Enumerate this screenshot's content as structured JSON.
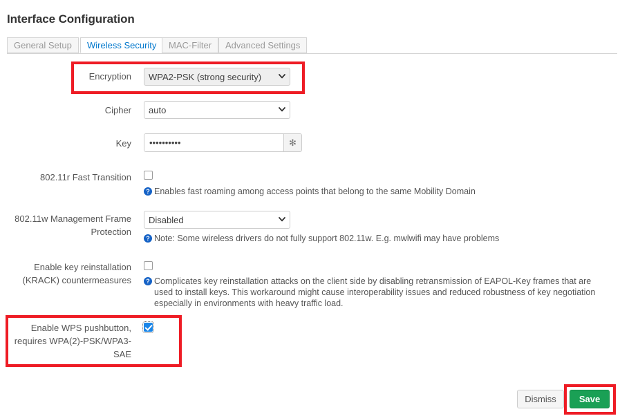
{
  "header": {
    "title": "Interface Configuration"
  },
  "tabs": [
    {
      "label": "General Setup",
      "active": false
    },
    {
      "label": "Wireless Security",
      "active": true
    },
    {
      "label": "MAC-Filter",
      "active": false
    },
    {
      "label": "Advanced Settings",
      "active": false
    }
  ],
  "form": {
    "encryption": {
      "label": "Encryption",
      "value": "WPA2-PSK (strong security)"
    },
    "cipher": {
      "label": "Cipher",
      "value": "auto"
    },
    "key": {
      "label": "Key",
      "value": "••••••••••",
      "placeholder": "",
      "reveal_label": "✻"
    },
    "fast_transition": {
      "label": "802.11r Fast Transition",
      "checked": false,
      "help_icon": "question-circle-icon",
      "hint": "Enables fast roaming among access points that belong to the same Mobility Domain"
    },
    "mfp": {
      "label": "802.11w Management Frame Protection",
      "value": "Disabled",
      "help_icon": "question-circle-icon",
      "hint": "Note: Some wireless drivers do not fully support 802.11w. E.g. mwlwifi may have problems"
    },
    "krack": {
      "label": "Enable key reinstallation (KRACK) countermeasures",
      "checked": false,
      "help_icon": "question-circle-icon",
      "hint": "Complicates key reinstallation attacks on the client side by disabling retransmission of EAPOL-Key frames that are used to install keys. This workaround might cause interoperability issues and reduced robustness of key negotiation especially in environments with heavy traffic load."
    },
    "wps": {
      "label": "Enable WPS pushbutton, requires WPA(2)-PSK/WPA3-SAE",
      "checked": true
    }
  },
  "footer": {
    "dismiss_label": "Dismiss",
    "save_label": "Save"
  },
  "colors": {
    "highlight": "#ee1c25",
    "save_green": "#1aa055",
    "active_tab_blue": "#0077cc",
    "help_blue": "#1562c6",
    "checkbox_blue": "#1a86e8"
  }
}
